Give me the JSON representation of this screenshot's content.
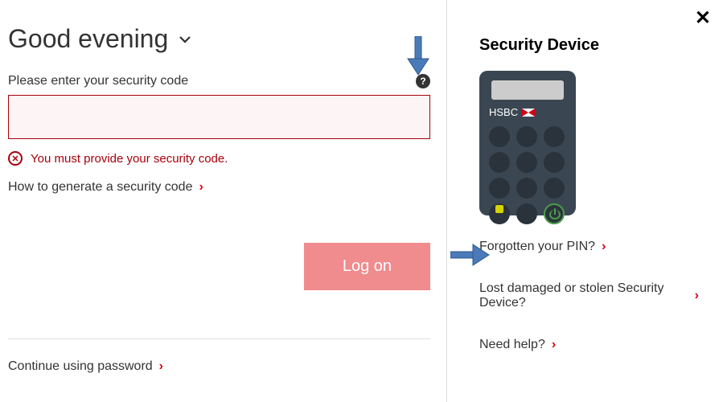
{
  "main": {
    "greeting": "Good evening",
    "field_label": "Please enter your security code",
    "error_text": "You must provide your security code.",
    "generate_link": "How to generate a security code",
    "logon_button": "Log on",
    "password_link": "Continue using password"
  },
  "side": {
    "title": "Security Device",
    "device_brand": "HSBC",
    "forgotten_pin": "Forgotten your PIN?",
    "lost_device": "Lost damaged or stolen Security Device?",
    "need_help": "Need help?"
  }
}
